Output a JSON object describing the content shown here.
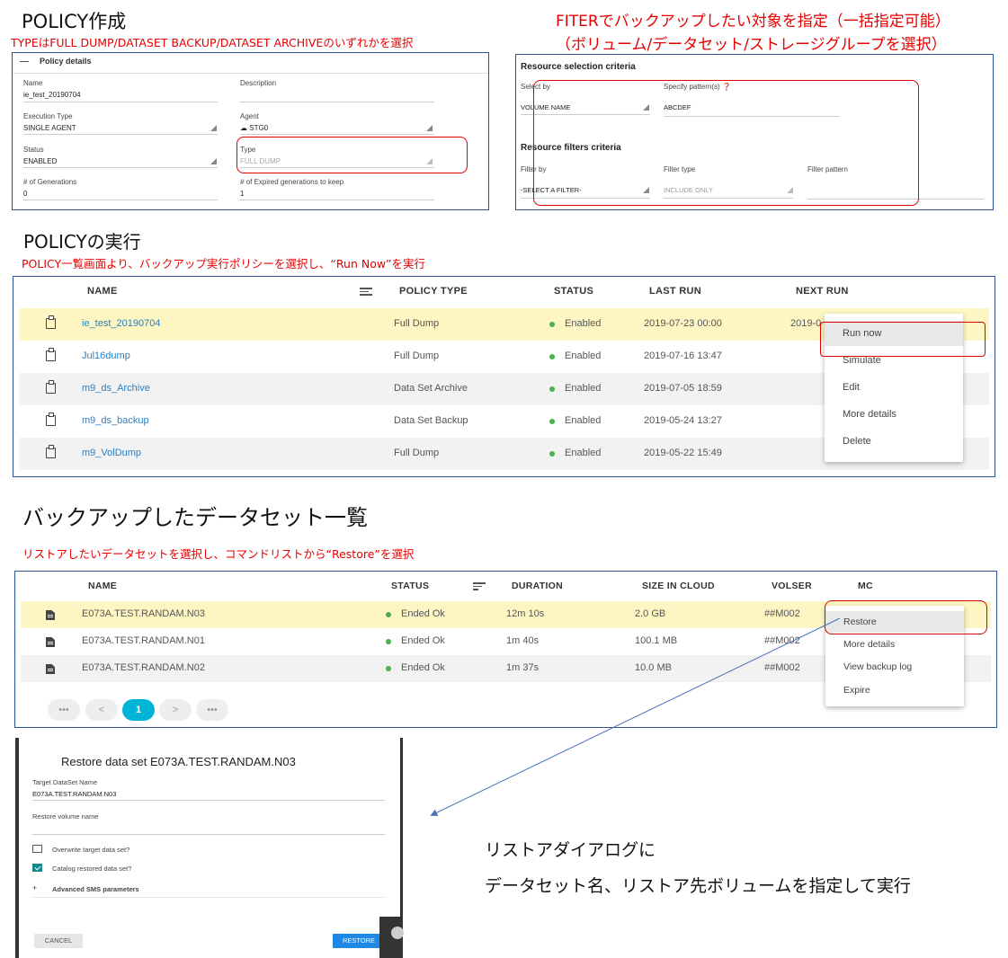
{
  "section1": {
    "title": "POLICY作成",
    "note": "TYPEはFULL DUMP/DATASET BACKUP/DATASET ARCHIVEのいずれかを選択",
    "filter_note_line1": "FITERでバックアップしたい対象を指定（一括指定可能）",
    "filter_note_line2": "（ボリューム/データセット/ストレージグループを選択）"
  },
  "policy_details": {
    "header": "Policy details",
    "name_label": "Name",
    "name_value": "ie_test_20190704",
    "description_label": "Description",
    "execution_type_label": "Execution Type",
    "execution_type_value": "SINGLE AGENT",
    "agent_label": "Agent",
    "agent_value": "STG0",
    "status_label": "Status",
    "status_value": "ENABLED",
    "type_label": "Type",
    "type_value": "FULL DUMP",
    "generations_label": "# of Generations",
    "generations_value": "0",
    "expired_label": "# of Expired generations to keep",
    "expired_value": "1"
  },
  "resource_selection": {
    "title": "Resource selection criteria",
    "select_by_label": "Select by",
    "select_by_value": "VOLUME NAME",
    "pattern_label": "Specify pattern(s)",
    "pattern_value": "ABCDEF",
    "filters_title": "Resource filters criteria",
    "filter_by_label": "Filter by",
    "filter_by_value": "-SELECT A FILTER-",
    "filter_type_label": "Filter type",
    "filter_type_value": "INCLUDE ONLY",
    "filter_pattern_label": "Filter pattern"
  },
  "section2": {
    "title": "POLICYの実行",
    "note": "POLICY一覧画面より、バックアップ実行ポリシーを選択し、“Run Now”を実行"
  },
  "policy_table": {
    "columns": [
      "NAME",
      "POLICY TYPE",
      "STATUS",
      "LAST RUN",
      "NEXT RUN"
    ],
    "rows": [
      {
        "name": "ie_test_20190704",
        "type": "Full Dump",
        "status": "Enabled",
        "last_run": "2019-07-23 00:00",
        "next_run": "2019-0"
      },
      {
        "name": "Jul16dump",
        "type": "Full Dump",
        "status": "Enabled",
        "last_run": "2019-07-16 13:47"
      },
      {
        "name": "m9_ds_Archive",
        "type": "Data Set Archive",
        "status": "Enabled",
        "last_run": "2019-07-05 18:59"
      },
      {
        "name": "m9_ds_backup",
        "type": "Data Set Backup",
        "status": "Enabled",
        "last_run": "2019-05-24 13:27"
      },
      {
        "name": "m9_VolDump",
        "type": "Full Dump",
        "status": "Enabled",
        "last_run": "2019-05-22 15:49"
      }
    ],
    "menu": [
      "Run now",
      "Simulate",
      "Edit",
      "More details",
      "Delete"
    ]
  },
  "section3": {
    "title": "バックアップしたデータセット一覧",
    "note": "リストアしたいデータセットを選択し、コマンドリストから“Restore”を選択"
  },
  "dataset_table": {
    "columns": [
      "NAME",
      "STATUS",
      "DURATION",
      "SIZE IN CLOUD",
      "VOLSER",
      "MC"
    ],
    "rows": [
      {
        "name": "E073A.TEST.RANDAM.N03",
        "status": "Ended Ok",
        "duration": "12m 10s",
        "size": "2.0 GB",
        "volser": "##M002"
      },
      {
        "name": "E073A.TEST.RANDAM.N01",
        "status": "Ended Ok",
        "duration": "1m 40s",
        "size": "100.1 MB",
        "volser": "##M002"
      },
      {
        "name": "E073A.TEST.RANDAM.N02",
        "status": "Ended Ok",
        "duration": "1m 37s",
        "size": "10.0 MB",
        "volser": "##M002"
      }
    ],
    "menu": [
      "Restore",
      "More details",
      "View backup log",
      "Expire"
    ],
    "pagination": {
      "first": "•••",
      "prev": "<",
      "current": "1",
      "next": ">",
      "last": "•••"
    }
  },
  "restore_dialog": {
    "title": "Restore data set E073A.TEST.RANDAM.N03",
    "target_label": "Target DataSet Name",
    "target_value": "E073A.TEST.RANDAM.N03",
    "volume_label": "Restore volume name",
    "overwrite_label": "Overwrite target data set?",
    "catalog_label": "Catalog restored data set?",
    "catalog_checked": true,
    "advanced_label": "Advanced SMS parameters",
    "cancel_label": "CANCEL",
    "restore_label": "RESTORE"
  },
  "dialog_note": {
    "line1": "リストアダイアログに",
    "line2": "データセット名、リストア先ボリュームを指定して実行"
  },
  "colors": {
    "annotation_red": "#e60000",
    "panel_border": "#2f5597",
    "selected_row": "#fdf6c3",
    "link_blue": "#2a7fc4",
    "status_green": "#4caf50",
    "page_active": "#00b4d8",
    "restore_button": "#1e88e5"
  }
}
